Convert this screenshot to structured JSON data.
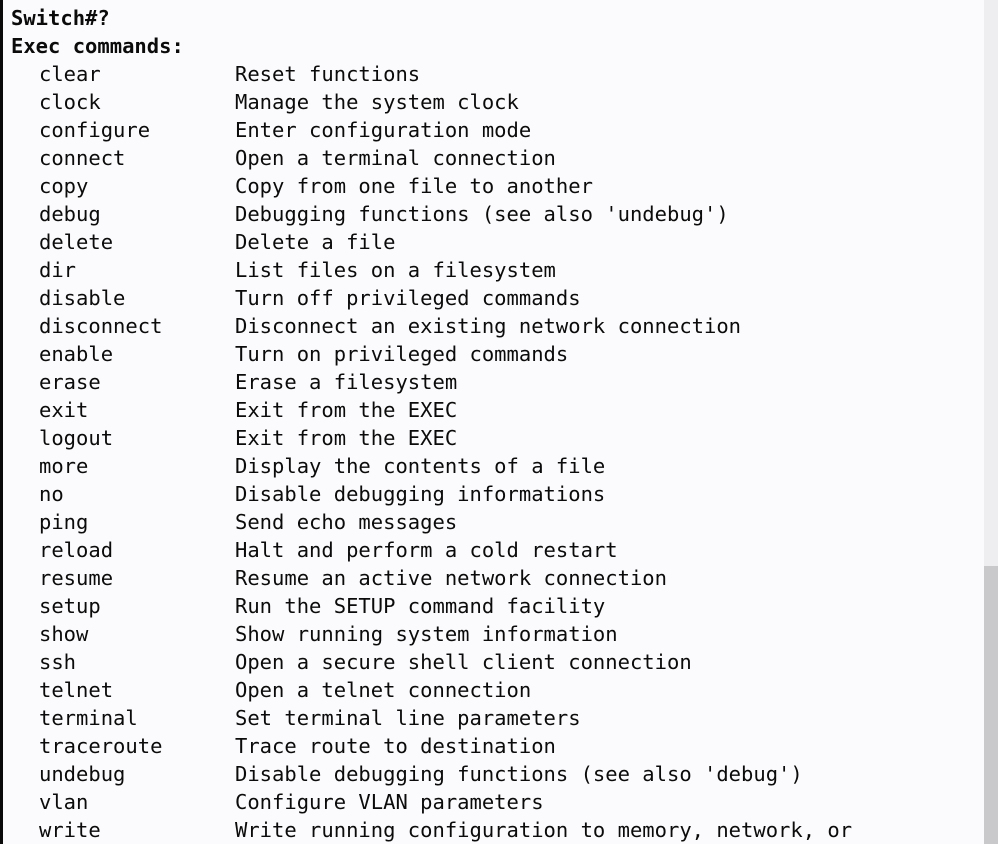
{
  "terminal": {
    "device_name": "Switch",
    "prompt": "Switch#?",
    "prompt_symbol": "#",
    "typed_command": "?",
    "header": "Exec commands:",
    "background_color": "#fbfafc",
    "text_color": "#0b0b0b",
    "scrollbar": {
      "track_color": "#c9c9cc",
      "thumb_color": "#eeeef1"
    },
    "commands": [
      {
        "name": "clear",
        "description": "Reset functions"
      },
      {
        "name": "clock",
        "description": "Manage the system clock"
      },
      {
        "name": "configure",
        "description": "Enter configuration mode"
      },
      {
        "name": "connect",
        "description": "Open a terminal connection"
      },
      {
        "name": "copy",
        "description": "Copy from one file to another"
      },
      {
        "name": "debug",
        "description": "Debugging functions (see also 'undebug')"
      },
      {
        "name": "delete",
        "description": "Delete a file"
      },
      {
        "name": "dir",
        "description": "List files on a filesystem"
      },
      {
        "name": "disable",
        "description": "Turn off privileged commands"
      },
      {
        "name": "disconnect",
        "description": "Disconnect an existing network connection"
      },
      {
        "name": "enable",
        "description": "Turn on privileged commands"
      },
      {
        "name": "erase",
        "description": "Erase a filesystem"
      },
      {
        "name": "exit",
        "description": "Exit from the EXEC"
      },
      {
        "name": "logout",
        "description": "Exit from the EXEC"
      },
      {
        "name": "more",
        "description": "Display the contents of a file"
      },
      {
        "name": "no",
        "description": "Disable debugging informations"
      },
      {
        "name": "ping",
        "description": "Send echo messages"
      },
      {
        "name": "reload",
        "description": "Halt and perform a cold restart"
      },
      {
        "name": "resume",
        "description": "Resume an active network connection"
      },
      {
        "name": "setup",
        "description": "Run the SETUP command facility"
      },
      {
        "name": "show",
        "description": "Show running system information"
      },
      {
        "name": "ssh",
        "description": "Open a secure shell client connection"
      },
      {
        "name": "telnet",
        "description": "Open a telnet connection"
      },
      {
        "name": "terminal",
        "description": "Set terminal line parameters"
      },
      {
        "name": "traceroute",
        "description": "Trace route to destination"
      },
      {
        "name": "undebug",
        "description": "Disable debugging functions (see also 'debug')"
      },
      {
        "name": "vlan",
        "description": "Configure VLAN parameters"
      },
      {
        "name": "write",
        "description": "Write running configuration to memory, network, or"
      }
    ]
  }
}
